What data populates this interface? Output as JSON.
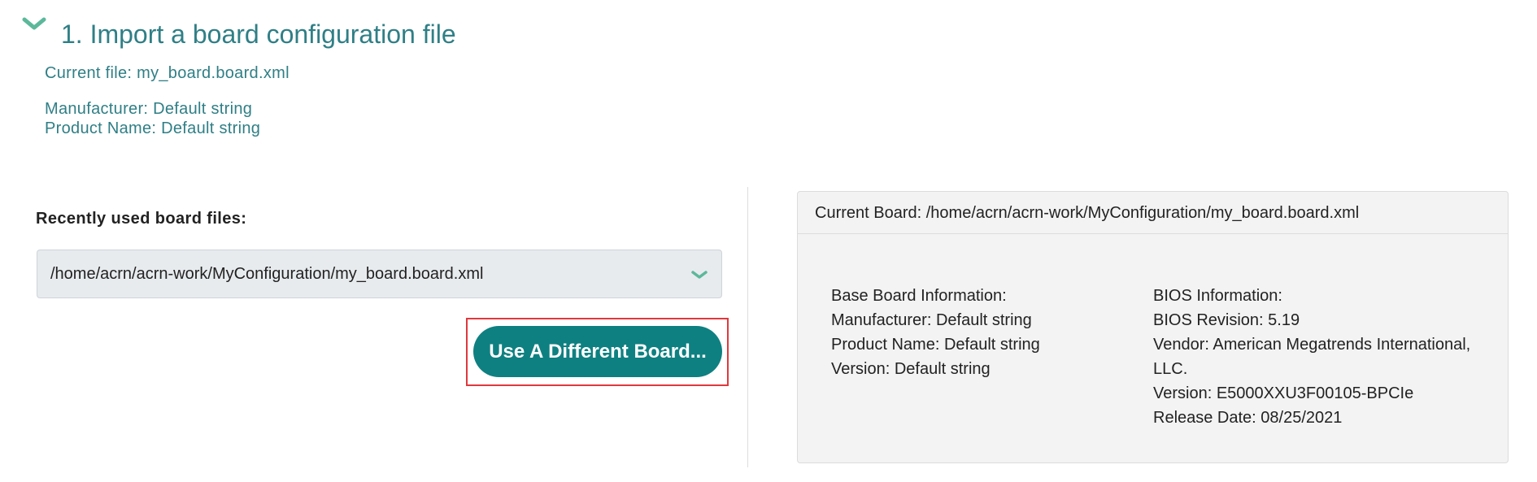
{
  "section": {
    "title": "1. Import a board configuration file",
    "current_file": "Current file: my_board.board.xml",
    "manufacturer": "Manufacturer: Default string",
    "product_name": "Product Name: Default string"
  },
  "recent": {
    "label": "Recently used board files:",
    "selected_value": "/home/acrn/acrn-work/MyConfiguration/my_board.board.xml"
  },
  "buttons": {
    "use_different_board": "Use A Different Board..."
  },
  "board_card": {
    "header": "Current Board: /home/acrn/acrn-work/MyConfiguration/my_board.board.xml",
    "base_board": {
      "heading": "Base Board Information:",
      "manufacturer": "Manufacturer: Default string",
      "product_name": "Product Name: Default string",
      "version": "Version: Default string"
    },
    "bios": {
      "heading": "BIOS Information:",
      "revision": "BIOS Revision: 5.19",
      "vendor_line1": "Vendor: American Megatrends International,",
      "vendor_line2": "LLC.",
      "version": "Version: E5000XXU3F00105-BPCIe",
      "release_date": "Release Date: 08/25/2021"
    }
  },
  "colors": {
    "accent_teal": "#2f7f86",
    "button_teal": "#0f8081",
    "chevron_green": "#5cb89a",
    "highlight_red": "#e0383e"
  },
  "icons": {
    "section_toggle": "chevron-down-icon",
    "select_toggle": "chevron-down-icon"
  }
}
